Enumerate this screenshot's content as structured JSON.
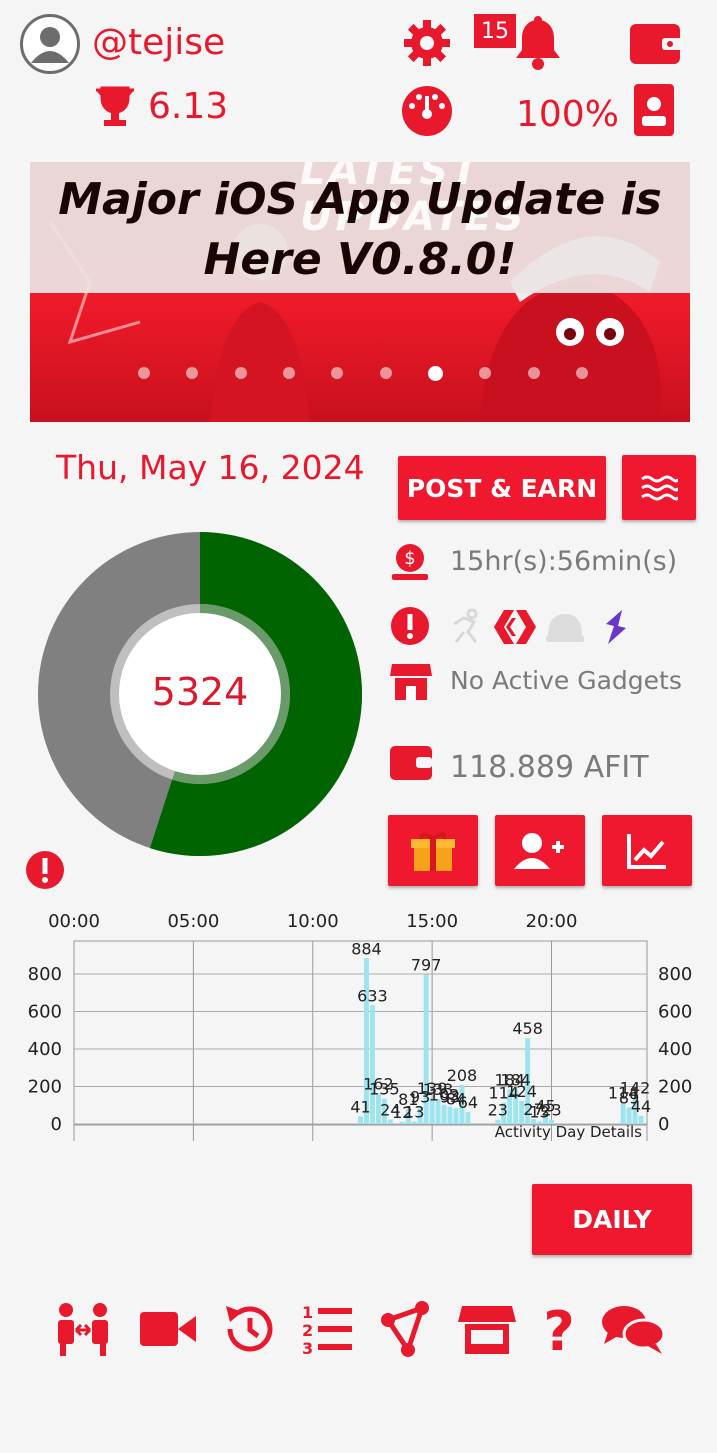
{
  "header": {
    "username": "@tejise",
    "score": "6.13",
    "notifications_count": "15",
    "battery_percent": "100%"
  },
  "banner": {
    "ghost_text": "LATEST UPDATES",
    "title_line1": "Major iOS App Update is",
    "title_line2": "Here V0.8.0!",
    "slide_count": 10,
    "active_slide": 7
  },
  "main": {
    "date": "Thu, May 16, 2024",
    "post_earn_label": "POST & EARN",
    "steps": "5324",
    "timer": "15hr(s):56min(s)",
    "gadgets": "No Active Gadgets",
    "balance": "118.889 AFIT",
    "daily_label": "DAILY"
  },
  "donut": {
    "progress_fraction": 0.55,
    "colors": {
      "done": "#006400",
      "remaining": "#808080"
    }
  },
  "chart_data": {
    "type": "bar",
    "title": "",
    "x_ticks": [
      "00:00",
      "05:00",
      "10:00",
      "15:00",
      "20:00"
    ],
    "y_ticks": [
      "0",
      "200",
      "400",
      "600",
      "800"
    ],
    "ylim": [
      0,
      900
    ],
    "annotation": "Activity Day Details",
    "bar_color": "#9ee4ee",
    "bars": [
      {
        "hour": 12.0,
        "value": 41
      },
      {
        "hour": 12.25,
        "value": 884
      },
      {
        "hour": 12.5,
        "value": 633
      },
      {
        "hour": 12.75,
        "value": 162
      },
      {
        "hour": 13.0,
        "value": 135
      },
      {
        "hour": 13.25,
        "value": 24
      },
      {
        "hour": 13.75,
        "value": 12
      },
      {
        "hour": 14.0,
        "value": 81
      },
      {
        "hour": 14.25,
        "value": 13
      },
      {
        "hour": 14.5,
        "value": 93
      },
      {
        "hour": 14.75,
        "value": 797
      },
      {
        "hour": 15.0,
        "value": 139
      },
      {
        "hour": 15.25,
        "value": 133
      },
      {
        "hour": 15.5,
        "value": 103
      },
      {
        "hour": 15.75,
        "value": 93
      },
      {
        "hour": 16.0,
        "value": 84
      },
      {
        "hour": 16.25,
        "value": 208
      },
      {
        "hour": 16.5,
        "value": 64
      },
      {
        "hour": 17.75,
        "value": 23
      },
      {
        "hour": 18.0,
        "value": 114
      },
      {
        "hour": 18.25,
        "value": 184
      },
      {
        "hour": 18.5,
        "value": 184
      },
      {
        "hour": 18.75,
        "value": 124
      },
      {
        "hour": 19.0,
        "value": 458
      },
      {
        "hour": 19.25,
        "value": 27
      },
      {
        "hour": 19.5,
        "value": 13
      },
      {
        "hour": 19.75,
        "value": 45
      },
      {
        "hour": 20.0,
        "value": 23
      },
      {
        "hour": 23.0,
        "value": 114
      },
      {
        "hour": 23.25,
        "value": 89
      },
      {
        "hour": 23.5,
        "value": 142
      },
      {
        "hour": 23.75,
        "value": 44
      }
    ]
  }
}
